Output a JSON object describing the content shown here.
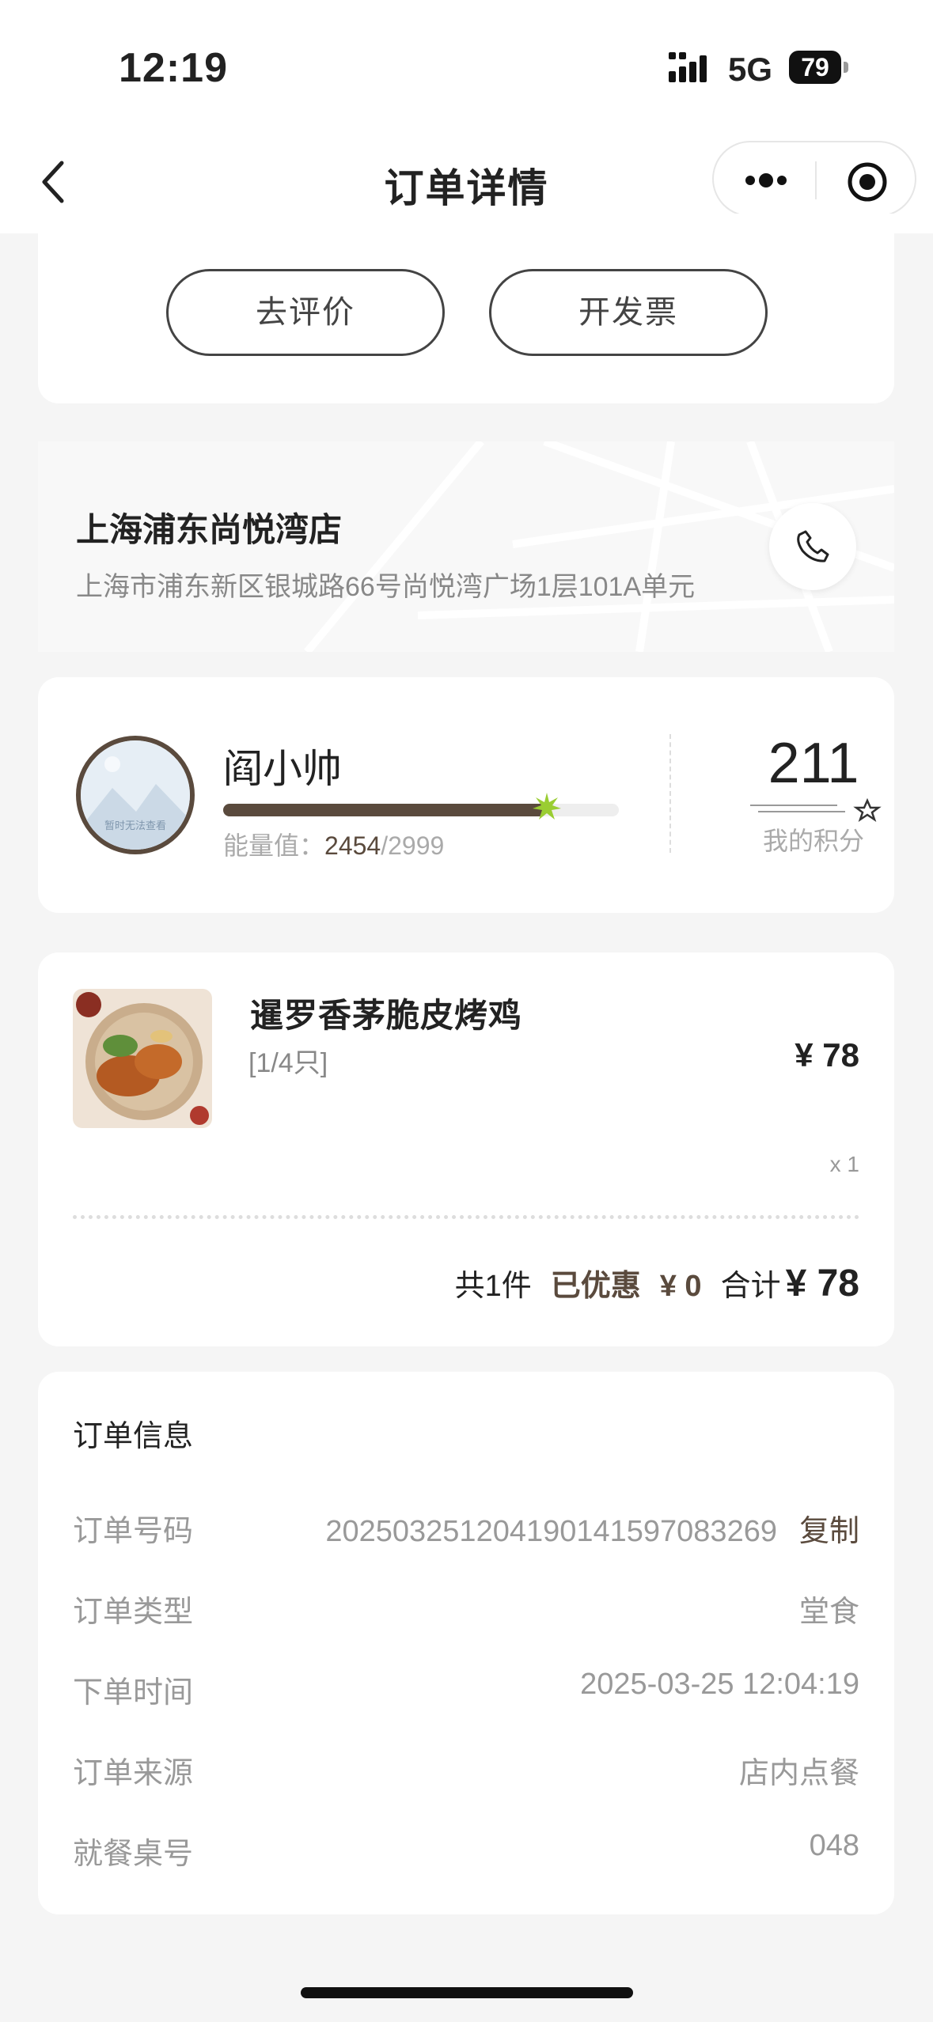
{
  "status_bar": {
    "time": "12:19",
    "network": "5G",
    "battery": "79"
  },
  "nav": {
    "title": "订单详情"
  },
  "actions": {
    "review": "去评价",
    "invoice": "开发票"
  },
  "store": {
    "name": "上海浦东尚悦湾店",
    "address": "上海市浦东新区银城路66号尚悦湾广场1层101A单元"
  },
  "member": {
    "name": "阎小帅",
    "energy_label": "能量值：",
    "energy_current": "2454",
    "energy_separator": "/",
    "energy_max": "2999",
    "energy_fraction": 0.818,
    "avatar_text": "暂时无法查看",
    "points": "211",
    "points_label": "我的积分"
  },
  "product": {
    "name": "暹罗香茅脆皮烤鸡",
    "spec": "[1/4只]",
    "price": "¥ 78",
    "qty": "x 1",
    "summary": {
      "count": "共1件",
      "discount_label": "已优惠",
      "discount_value": "¥ 0",
      "total_label": "合计",
      "total_value": "¥ 78"
    }
  },
  "order_info": {
    "title": "订单信息",
    "rows": [
      {
        "label": "订单号码",
        "value": "20250325120419014159708326​9",
        "action": "复制"
      },
      {
        "label": "订单类型",
        "value": "堂食"
      },
      {
        "label": "下单时间",
        "value": "2025-03-25 12:04:19"
      },
      {
        "label": "订单来源",
        "value": "店内点餐"
      },
      {
        "label": "就餐桌号",
        "value": "048"
      }
    ]
  },
  "colors": {
    "brand_brown": "#5a4a3d",
    "energy_star": "#9acd32"
  }
}
